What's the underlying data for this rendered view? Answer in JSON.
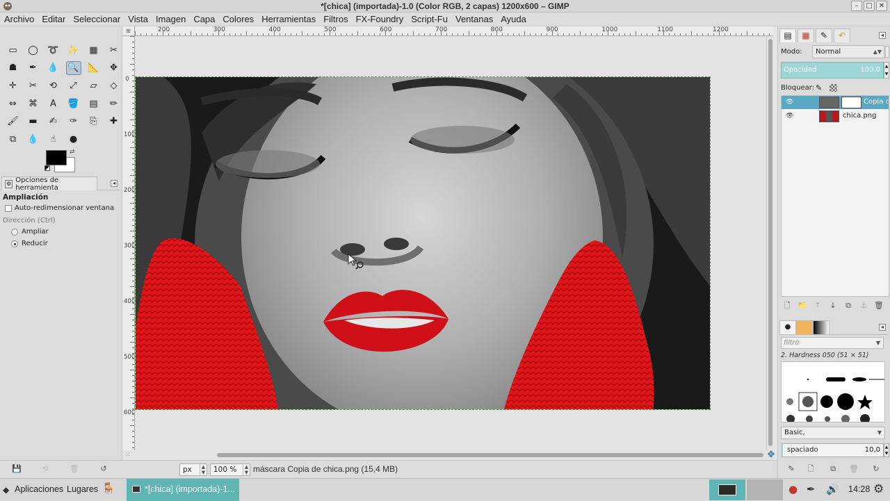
{
  "window": {
    "title": "*[chica] (importada)-1.0 (Color RGB, 2 capas) 1200x600 – GIMP",
    "controls": [
      "–",
      "□",
      "✕"
    ]
  },
  "menu": [
    "Archivo",
    "Editar",
    "Seleccionar",
    "Vista",
    "Imagen",
    "Capa",
    "Colores",
    "Herramientas",
    "Filtros",
    "FX-Foundry",
    "Script-Fu",
    "Ventanas",
    "Ayuda"
  ],
  "toolbox": {
    "tools": [
      {
        "name": "rect-select-icon",
        "glyph": "▭"
      },
      {
        "name": "ellipse-select-icon",
        "glyph": "◯"
      },
      {
        "name": "free-select-icon",
        "glyph": "➰"
      },
      {
        "name": "fuzzy-select-icon",
        "glyph": "✨"
      },
      {
        "name": "color-select-icon",
        "glyph": "▦"
      },
      {
        "name": "scissors-icon",
        "glyph": "✂"
      },
      {
        "name": "foreground-select-icon",
        "glyph": "☗"
      },
      {
        "name": "paths-icon",
        "glyph": "✒"
      },
      {
        "name": "color-picker-icon",
        "glyph": "💧"
      },
      {
        "name": "zoom-icon",
        "glyph": "🔍"
      },
      {
        "name": "measure-icon",
        "glyph": "📐"
      },
      {
        "name": "move-icon",
        "glyph": "✥"
      },
      {
        "name": "align-icon",
        "glyph": "✛"
      },
      {
        "name": "crop-icon",
        "glyph": "✂"
      },
      {
        "name": "rotate-icon",
        "glyph": "⟲"
      },
      {
        "name": "scale-icon",
        "glyph": "⤢"
      },
      {
        "name": "shear-icon",
        "glyph": "▱"
      },
      {
        "name": "perspective-icon",
        "glyph": "◇"
      },
      {
        "name": "flip-icon",
        "glyph": "⇔"
      },
      {
        "name": "cage-icon",
        "glyph": "⌘"
      },
      {
        "name": "text-icon",
        "glyph": "A"
      },
      {
        "name": "bucket-fill-icon",
        "glyph": "🪣"
      },
      {
        "name": "blend-icon",
        "glyph": "▤"
      },
      {
        "name": "pencil-icon",
        "glyph": "✏"
      },
      {
        "name": "paintbrush-icon",
        "glyph": "🖌"
      },
      {
        "name": "eraser-icon",
        "glyph": "▬"
      },
      {
        "name": "airbrush-icon",
        "glyph": "✍"
      },
      {
        "name": "ink-icon",
        "glyph": "✑"
      },
      {
        "name": "clone-icon",
        "glyph": "⎘"
      },
      {
        "name": "heal-icon",
        "glyph": "✚"
      },
      {
        "name": "perspective-clone-icon",
        "glyph": "⧉"
      },
      {
        "name": "blur-icon",
        "glyph": "💧"
      },
      {
        "name": "smudge-icon",
        "glyph": "☝"
      },
      {
        "name": "dodge-burn-icon",
        "glyph": "●"
      }
    ],
    "active_tool_index": 9,
    "options_tab": "Opciones de herramienta",
    "options": {
      "heading": "Ampliación",
      "auto_resize": "Auto-redimensionar ventana",
      "direction_label": "Dirección (Ctrl)",
      "zoom_in": "Ampliar",
      "zoom_out": "Reducir"
    }
  },
  "rulers": {
    "h_ticks": [
      "200",
      "300",
      "400",
      "500",
      "600",
      "700",
      "800",
      "900",
      "1000",
      "1100",
      "1200"
    ],
    "v_ticks": [
      "0",
      "100",
      "200",
      "300",
      "400",
      "500",
      "600"
    ]
  },
  "status": {
    "unit": "px",
    "zoom": "100 %",
    "message": "máscara Copia de chica.png (15,4 MB)"
  },
  "layers_dock": {
    "mode_label": "Modo:",
    "mode_value": "Normal",
    "opacity_label": "Opacidad",
    "opacity_value": "100,0",
    "lock_label": "Bloquear:",
    "layers": [
      {
        "name": "Copia d",
        "selected": true
      },
      {
        "name": "chica.png",
        "selected": false
      }
    ]
  },
  "brushes_dock": {
    "filter_placeholder": "filtro",
    "brush_name": "2. Hardness 050 (51 × 51)",
    "brush_set": "Basic,",
    "spacing_label": "spaciado",
    "spacing_value": "10,0"
  },
  "taskbar": {
    "apps": "Aplicaciones",
    "places": "Lugares",
    "gimp_task": "*[chica] (importada)-1...",
    "clock": "14:28"
  },
  "colors": {
    "selection": "#5aa8c4",
    "accent": "#5fb4b4",
    "red_knit": "#e0161b",
    "lips": "#d01018"
  }
}
